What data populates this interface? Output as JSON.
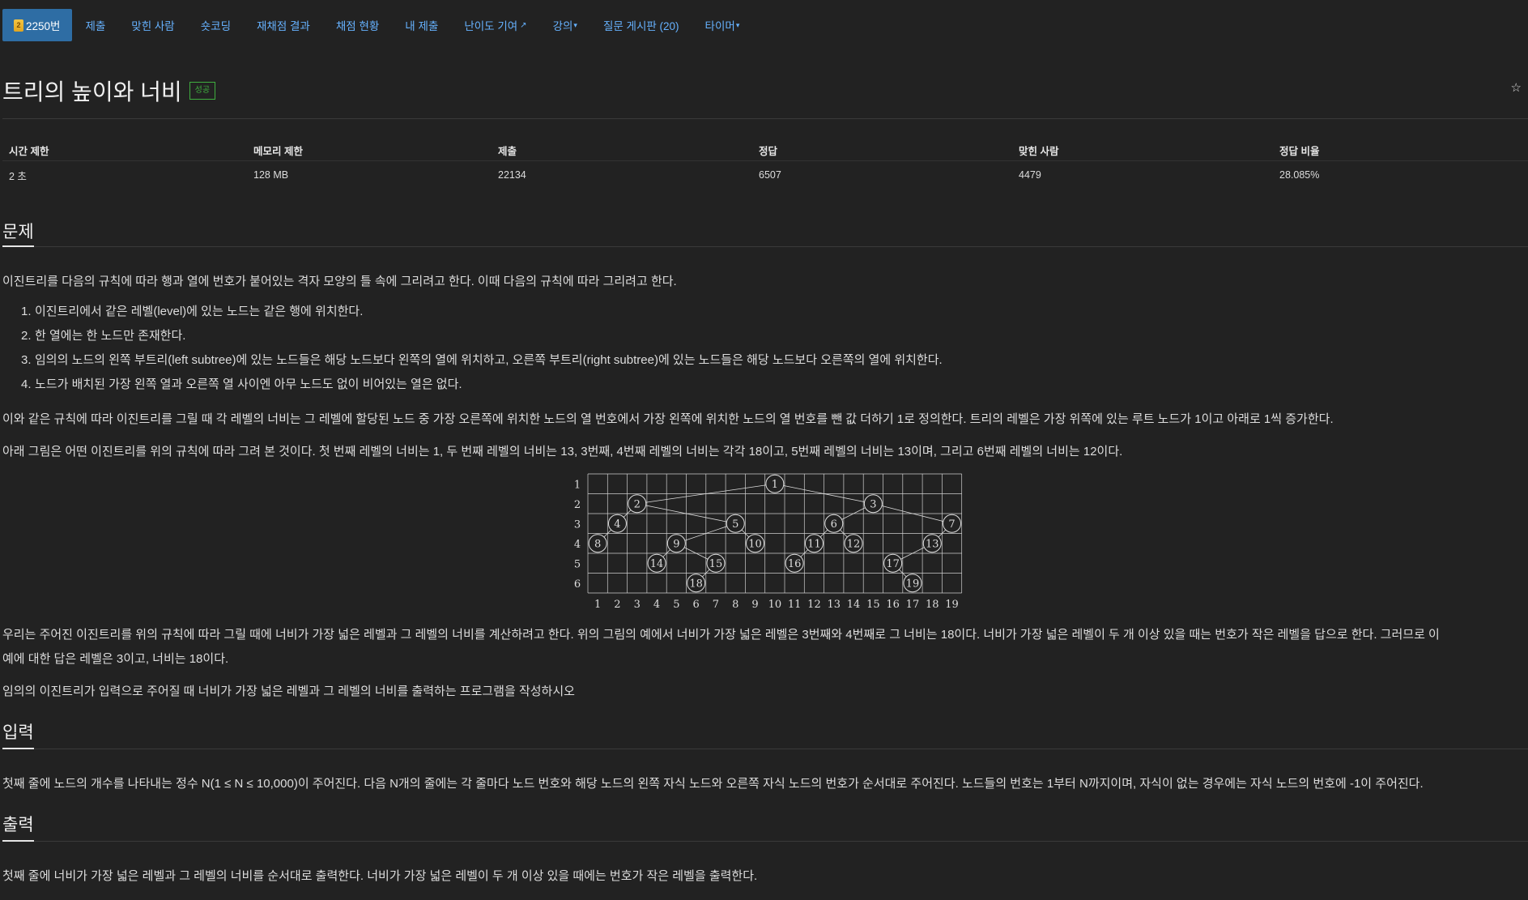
{
  "nav": {
    "problem_tab": "2250번",
    "tier_mark": "2",
    "items": [
      {
        "label": "제출"
      },
      {
        "label": "맞힌 사람"
      },
      {
        "label": "숏코딩"
      },
      {
        "label": "재채점 결과"
      },
      {
        "label": "채점 현황"
      },
      {
        "label": "내 제출"
      },
      {
        "label": "난이도 기여"
      },
      {
        "label": "강의"
      },
      {
        "label": "질문 게시판 (20)"
      },
      {
        "label": "타이머"
      }
    ]
  },
  "title": "트리의 높이와 너비",
  "status_badge": "성공",
  "info_table": {
    "headers": [
      "시간 제한",
      "메모리 제한",
      "제출",
      "정답",
      "맞힌 사람",
      "정답 비율"
    ],
    "values": [
      "2 초",
      "128 MB",
      "22134",
      "6507",
      "4479",
      "28.085%"
    ]
  },
  "sections": {
    "problem": {
      "heading": "문제",
      "intro": "이진트리를 다음의 규칙에 따라 행과 열에 번호가 붙어있는 격자 모양의 틀 속에 그리려고 한다. 이때 다음의 규칙에 따라 그리려고 한다.",
      "rules": [
        "이진트리에서 같은 레벨(level)에 있는 노드는 같은 행에 위치한다.",
        "한 열에는 한 노드만 존재한다.",
        "임의의 노드의 왼쪽 부트리(left subtree)에 있는 노드들은 해당 노드보다 왼쪽의 열에 위치하고, 오른쪽 부트리(right subtree)에 있는 노드들은 해당 노드보다 오른쪽의 열에 위치한다.",
        "노드가 배치된 가장 왼쪽 열과 오른쪽 열 사이엔 아무 노드도 없이 비어있는 열은 없다."
      ],
      "para1": "이와 같은 규칙에 따라 이진트리를 그릴 때 각 레벨의 너비는 그 레벨에 할당된 노드 중 가장 오른쪽에 위치한 노드의 열 번호에서 가장 왼쪽에 위치한 노드의 열 번호를 뺀 값 더하기 1로 정의한다. 트리의 레벨은 가장 위쪽에 있는 루트 노드가 1이고 아래로 1씩 증가한다.",
      "para2": "아래 그림은 어떤 이진트리를 위의 규칙에 따라 그려 본 것이다. 첫 번째 레벨의 너비는 1, 두 번째 레벨의 너비는 13, 3번째, 4번째 레벨의 너비는 각각 18이고, 5번째 레벨의 너비는 13이며, 그리고 6번째 레벨의 너비는 12이다.",
      "para3a": "우리는 주어진 이진트리를 위의 규칙에 따라 그릴 때에 너비가 가장 넓은 레벨과 그 레벨의 너비를 계산하려고 한다. 위의 그림의 예에서 너비가 가장 넓은 레벨은 3번째와 4번째로 그 너비는 18이다. 너비가 가장 넓은 레벨이 두 개 이상 있을 때는 번호가 작은 레벨을 답으로 한다. 그러므로 이",
      "para3b": "예에 대한 답은 레벨은 3이고, 너비는 18이다.",
      "para4": "임의의 이진트리가 입력으로 주어질 때 너비가 가장 넓은 레벨과 그 레벨의 너비를 출력하는 프로그램을 작성하시오"
    },
    "input": {
      "heading": "입력",
      "text": "첫째 줄에 노드의 개수를 나타내는 정수 N(1 ≤ N ≤ 10,000)이 주어진다. 다음 N개의 줄에는 각 줄마다 노드 번호와 해당 노드의 왼쪽 자식 노드와 오른쪽 자식 노드의 번호가 순서대로 주어진다. 노드들의 번호는 1부터 N까지이며, 자식이 없는 경우에는 자식 노드의 번호에 -1이 주어진다."
    },
    "output": {
      "heading": "출력",
      "text": "첫째 줄에 너비가 가장 넓은 레벨과 그 레벨의 너비를 순서대로 출력한다. 너비가 가장 넓은 레벨이 두 개 이상 있을 때에는 번호가 작은 레벨을 출력한다."
    }
  },
  "figure": {
    "row_labels": [
      "1",
      "2",
      "3",
      "4",
      "5",
      "6"
    ],
    "col_labels": [
      "1",
      "2",
      "3",
      "4",
      "5",
      "6",
      "7",
      "8",
      "9",
      "10",
      "11",
      "12",
      "13",
      "14",
      "15",
      "16",
      "17",
      "18",
      "19"
    ],
    "nodes": [
      {
        "label": "1",
        "col": 10,
        "row": 1
      },
      {
        "label": "2",
        "col": 3,
        "row": 2
      },
      {
        "label": "3",
        "col": 15,
        "row": 2
      },
      {
        "label": "4",
        "col": 2,
        "row": 3
      },
      {
        "label": "5",
        "col": 8,
        "row": 3
      },
      {
        "label": "6",
        "col": 13,
        "row": 3
      },
      {
        "label": "7",
        "col": 19,
        "row": 3
      },
      {
        "label": "8",
        "col": 1,
        "row": 4
      },
      {
        "label": "9",
        "col": 5,
        "row": 4
      },
      {
        "label": "10",
        "col": 9,
        "row": 4
      },
      {
        "label": "11",
        "col": 12,
        "row": 4
      },
      {
        "label": "12",
        "col": 14,
        "row": 4
      },
      {
        "label": "13",
        "col": 18,
        "row": 4
      },
      {
        "label": "14",
        "col": 4,
        "row": 5
      },
      {
        "label": "15",
        "col": 7,
        "row": 5
      },
      {
        "label": "16",
        "col": 11,
        "row": 5
      },
      {
        "label": "17",
        "col": 16,
        "row": 5
      },
      {
        "label": "18",
        "col": 6,
        "row": 6
      },
      {
        "label": "19",
        "col": 17,
        "row": 6
      }
    ],
    "edges": [
      [
        1,
        2
      ],
      [
        1,
        3
      ],
      [
        2,
        4
      ],
      [
        2,
        5
      ],
      [
        3,
        6
      ],
      [
        3,
        7
      ],
      [
        4,
        8
      ],
      [
        5,
        9
      ],
      [
        5,
        10
      ],
      [
        6,
        11
      ],
      [
        6,
        12
      ],
      [
        7,
        13
      ],
      [
        9,
        14
      ],
      [
        9,
        15
      ],
      [
        11,
        16
      ],
      [
        13,
        17
      ],
      [
        15,
        18
      ],
      [
        17,
        19
      ]
    ]
  },
  "colors": {
    "background": "#222222",
    "link": "#66b2ff",
    "active_tab": "#2e6da4",
    "success": "#3fae3f"
  }
}
